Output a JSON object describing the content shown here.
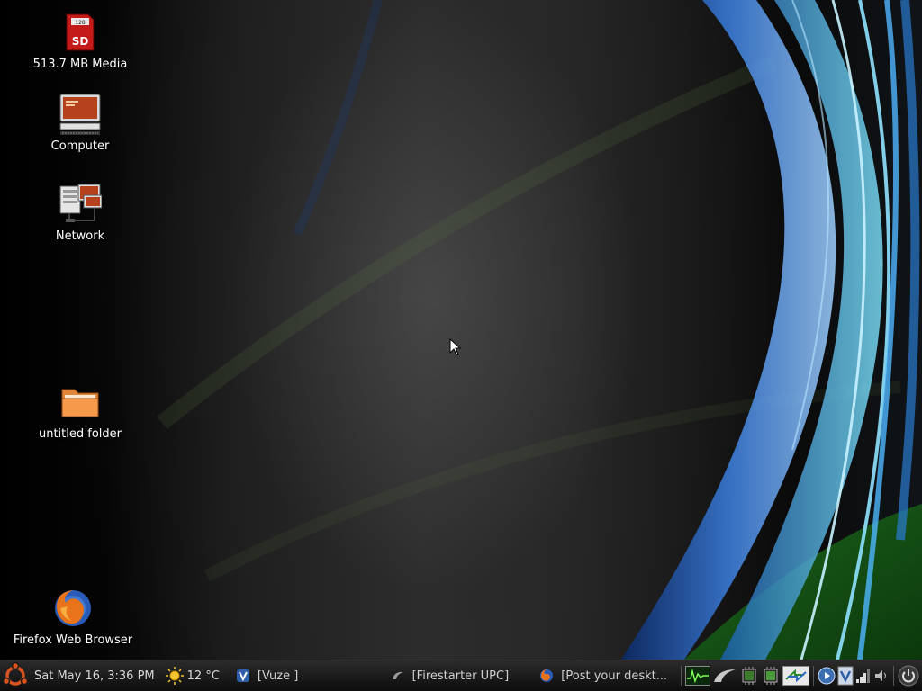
{
  "desktop": {
    "icons": [
      {
        "label": "513.7 MB Media",
        "icon": "sd-card-icon"
      },
      {
        "label": "Computer",
        "icon": "computer-icon"
      },
      {
        "label": "Network",
        "icon": "network-icon"
      },
      {
        "label": "untitled folder",
        "icon": "folder-icon"
      },
      {
        "label": "Firefox Web Browser",
        "icon": "firefox-icon"
      }
    ],
    "sd_card_badge": "SD",
    "sd_card_capacity": "128"
  },
  "panel": {
    "menu_icon": "ubuntu-logo-icon",
    "clock": "Sat May 16,  3:36 PM",
    "weather": {
      "icon": "sun-icon",
      "temperature": "12 °C"
    },
    "tasks": [
      {
        "label": "[Vuze    ]",
        "icon": "vuze-icon"
      },
      {
        "label": "[Firestarter UPC]",
        "icon": "firestarter-icon"
      },
      {
        "label": "[Post your deskt...",
        "icon": "firefox-icon"
      }
    ],
    "tray_icons": [
      "system-monitor-icon",
      "firestarter-tray-icon",
      "cpu-monitor-icon",
      "memory-monitor-icon",
      "network-transfer-icon",
      "media-player-icon",
      "vuze-tray-icon",
      "signal-strength-icon",
      "volume-icon",
      "power-icon"
    ]
  },
  "colors": {
    "panel_bg": "#1a1a1a",
    "label_text": "#ffffff",
    "panel_text": "#d8d8d8"
  }
}
